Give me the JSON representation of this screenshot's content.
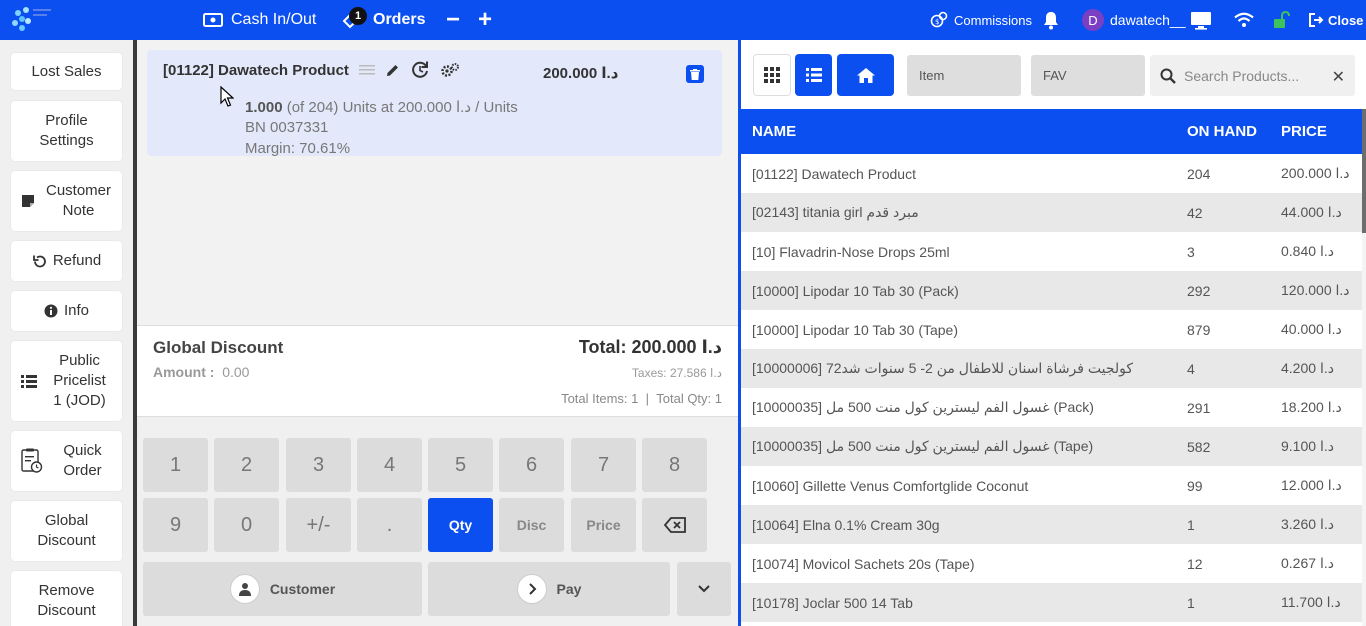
{
  "topbar": {
    "cash_label": "Cash In/Out",
    "orders_label": "Orders",
    "orders_badge": "1",
    "minus_label": "−",
    "plus_label": "+",
    "commissions_label": "Commissions",
    "user_initial": "D",
    "user_name": "dawatech__",
    "close_label": "Close",
    "accent_color": "#0b4ff0"
  },
  "sidebar": {
    "lost_sales": "Lost Sales",
    "profile_settings_1": "Profile",
    "profile_settings_2": "Settings",
    "customer_note_1": "Customer",
    "customer_note_2": "Note",
    "refund": "Refund",
    "info": "Info",
    "pricelist_1": "Public",
    "pricelist_2": "Pricelist",
    "pricelist_3": "1 (JOD)",
    "quick_order_1": "Quick",
    "quick_order_2": "Order",
    "global_discount_1": "Global",
    "global_discount_2": "Discount",
    "remove_discount_1": "Remove",
    "remove_discount_2": "Discount"
  },
  "orderline": {
    "name": "[01122] Dawatech Product",
    "price": "200.000 د.ا",
    "qty": "1.000",
    "qty_detail": "(of 204) Units at 200.000 د.ا / Units",
    "batch": "BN 0037331",
    "margin": "Margin: 70.61%"
  },
  "summary": {
    "global_discount": "Global Discount",
    "amount_label": "Amount :",
    "amount_value": "0.00",
    "total": "Total: 200.000 د.ا",
    "taxes": "Taxes: 27.586 د.ا",
    "total_items": "Total Items: 1",
    "separator": "|",
    "total_qty": "Total Qty: 1"
  },
  "numpad": {
    "k1": "1",
    "k2": "2",
    "k3": "3",
    "k4": "4",
    "k5": "5",
    "k6": "6",
    "k7": "7",
    "k8": "8",
    "k9": "9",
    "k0": "0",
    "kpm": "+/-",
    "kdot": ".",
    "qty": "Qty",
    "disc": "Disc",
    "price": "Price",
    "customer": "Customer",
    "pay": "Pay"
  },
  "products": {
    "tab_item": "Item",
    "tab_fav": "FAV",
    "search_placeholder": "Search Products...",
    "search_clear": "✕",
    "columns": {
      "name": "NAME",
      "on_hand": "ON HAND",
      "price": "PRICE"
    },
    "rows": [
      {
        "name": "[01122] Dawatech Product",
        "on_hand": "204",
        "price": "200.000 د.ا"
      },
      {
        "name": "[02143] titania girl مبرد قدم",
        "on_hand": "42",
        "price": "44.000 د.ا"
      },
      {
        "name": "[10] Flavadrin-Nose Drops 25ml",
        "on_hand": "3",
        "price": "0.840 د.ا"
      },
      {
        "name": "[10000] Lipodar 10 Tab 30 (Pack)",
        "on_hand": "292",
        "price": "120.000 د.ا"
      },
      {
        "name": "[10000] Lipodar 10 Tab 30 (Tape)",
        "on_hand": "879",
        "price": "40.000 د.ا"
      },
      {
        "name": "[10000006] كولجيت فرشاة اسنان للاطفال من 2- 5 سنوات شد72",
        "on_hand": "4",
        "price": "4.200 د.ا"
      },
      {
        "name": "[10000035] غسول الفم ليسترين كول منت 500 مل (Pack)",
        "on_hand": "291",
        "price": "18.200 د.ا"
      },
      {
        "name": "[10000035] غسول الفم ليسترين كول منت 500 مل (Tape)",
        "on_hand": "582",
        "price": "9.100 د.ا"
      },
      {
        "name": "[10060] Gillette Venus Comfortglide Coconut",
        "on_hand": "99",
        "price": "12.000 د.ا"
      },
      {
        "name": "[10064] Elna 0.1% Cream 30g",
        "on_hand": "1",
        "price": "3.260 د.ا"
      },
      {
        "name": "[10074] Movicol Sachets 20s (Tape)",
        "on_hand": "12",
        "price": "0.267 د.ا"
      },
      {
        "name": "[10178] Joclar 500 14 Tab",
        "on_hand": "1",
        "price": "11.700 د.ا"
      }
    ]
  }
}
